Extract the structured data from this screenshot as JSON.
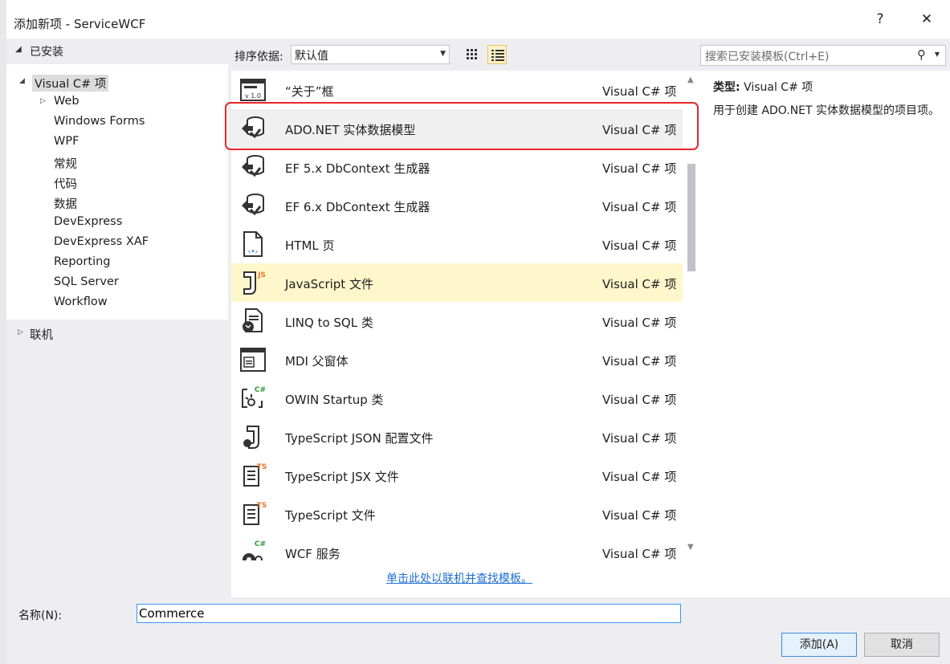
{
  "window": {
    "title": "添加新项 - ServiceWCF",
    "help": "?",
    "close": "✕"
  },
  "installed": {
    "header": "已安装",
    "tree": [
      {
        "label": "Visual C# 项",
        "level": 0,
        "expander": "◢",
        "selected": true
      },
      {
        "label": "Web",
        "level": 1,
        "expander": "▷"
      },
      {
        "label": "Windows Forms",
        "level": 1
      },
      {
        "label": "WPF",
        "level": 1
      },
      {
        "label": "常规",
        "level": 1
      },
      {
        "label": "代码",
        "level": 1
      },
      {
        "label": "数据",
        "level": 1
      },
      {
        "label": "DevExpress",
        "level": 1
      },
      {
        "label": "DevExpress XAF",
        "level": 1
      },
      {
        "label": "Reporting",
        "level": 1
      },
      {
        "label": "SQL Server",
        "level": 1
      },
      {
        "label": "Workflow",
        "level": 1
      }
    ],
    "online": {
      "label": "联机",
      "expander": "▷"
    }
  },
  "sort": {
    "label": "排序依据:",
    "value": "默认值"
  },
  "search": {
    "placeholder": "搜索已安装模板(Ctrl+E)"
  },
  "items": [
    {
      "name": "“关于”框",
      "type": "Visual C# 项",
      "icon": "about-box-icon"
    },
    {
      "name": "ADO.NET 实体数据模型",
      "type": "Visual C# 项",
      "icon": "entity-model-icon"
    },
    {
      "name": "EF 5.x DbContext 生成器",
      "type": "Visual C# 项",
      "icon": "dbcontext-generator-icon"
    },
    {
      "name": "EF 6.x DbContext 生成器",
      "type": "Visual C# 项",
      "icon": "dbcontext-generator-icon"
    },
    {
      "name": "HTML 页",
      "type": "Visual C# 项",
      "icon": "html-page-icon"
    },
    {
      "name": "JavaScript 文件",
      "type": "Visual C# 项",
      "icon": "javascript-file-icon"
    },
    {
      "name": "LINQ to SQL 类",
      "type": "Visual C# 项",
      "icon": "linq-to-sql-icon"
    },
    {
      "name": "MDI 父窗体",
      "type": "Visual C# 项",
      "icon": "mdi-form-icon"
    },
    {
      "name": "OWIN Startup 类",
      "type": "Visual C# 项",
      "icon": "owin-startup-icon"
    },
    {
      "name": "TypeScript JSON 配置文件",
      "type": "Visual C# 项",
      "icon": "typescript-json-icon"
    },
    {
      "name": "TypeScript JSX 文件",
      "type": "Visual C# 项",
      "icon": "typescript-jsx-icon"
    },
    {
      "name": "TypeScript 文件",
      "type": "Visual C# 项",
      "icon": "typescript-file-icon"
    },
    {
      "name": "WCF 服务",
      "type": "Visual C# 项",
      "icon": "wcf-service-icon"
    }
  ],
  "online_link": "单击此处以联机并查找模板。",
  "details": {
    "type_label": "类型:",
    "type_value": "Visual C# 项",
    "description": "用于创建 ADO.NET 实体数据模型的项目项。"
  },
  "name_field": {
    "label": "名称(N):",
    "value": "Commerce"
  },
  "buttons": {
    "add": "添加(A)",
    "cancel": "取消"
  },
  "colors": {
    "highlight_box": "#e8262a",
    "hover_row": "#fff7cc",
    "link": "#1e6fd0"
  }
}
